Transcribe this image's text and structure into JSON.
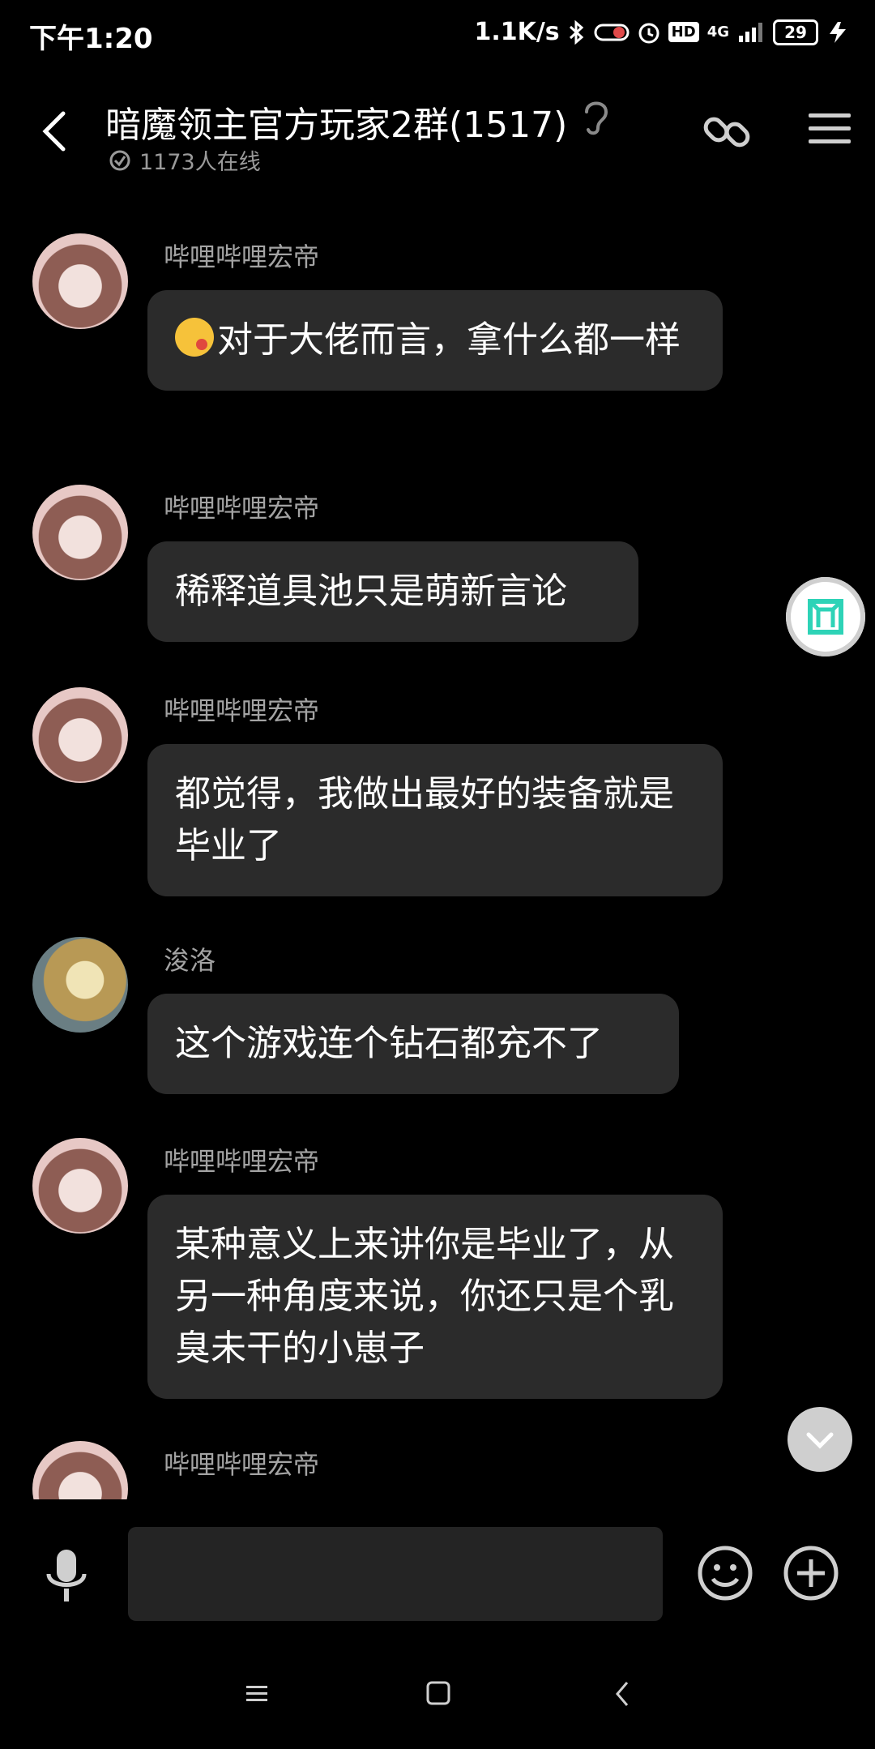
{
  "status_bar": {
    "time": "下午1:20",
    "net_speed": "1.1K/s",
    "hd_label": "HD",
    "network": "4G",
    "battery": "29"
  },
  "header": {
    "title": "暗魔领主官方玩家2群(1517)",
    "online_count": "1173人在线"
  },
  "messages": [
    {
      "sender": "哔哩哔哩宏帝",
      "text": "对于大佬而言，拿什么都一样",
      "has_emoji": true
    },
    {
      "sender": "哔哩哔哩宏帝",
      "text": "稀释道具池只是萌新言论"
    },
    {
      "sender": "哔哩哔哩宏帝",
      "text": "都觉得，我做出最好的装备就是毕业了"
    },
    {
      "sender": "浚洛",
      "text": "这个游戏连个钻石都充不了"
    },
    {
      "sender": "哔哩哔哩宏帝",
      "text": "某种意义上来讲你是毕业了，从另一种角度来说，你还只是个乳臭未干的小崽子"
    },
    {
      "sender": "哔哩哔哩宏帝",
      "text": ""
    }
  ],
  "input": {
    "value": "",
    "placeholder": ""
  },
  "colors": {
    "background": "#000000",
    "bubble": "#2b2b2b",
    "sender": "#a3a3a3",
    "accent": "#2ed3b7"
  }
}
